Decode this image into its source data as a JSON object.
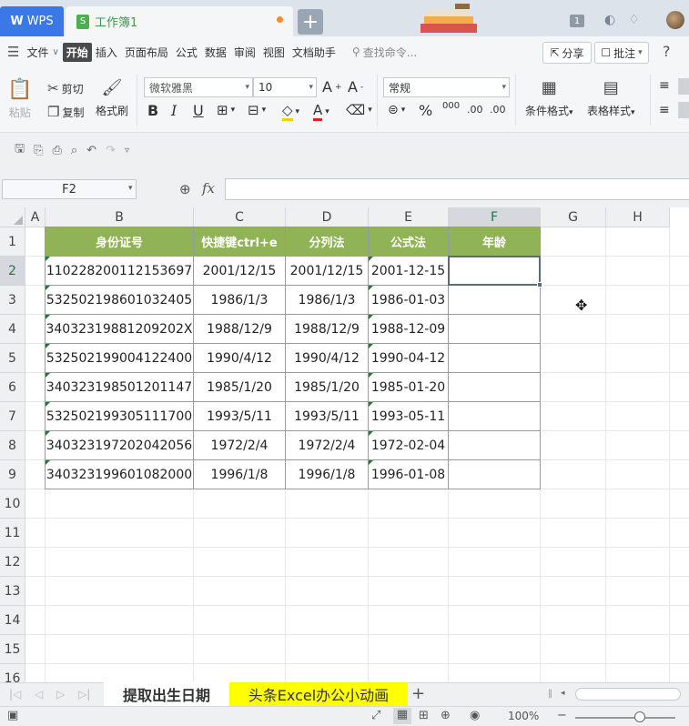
{
  "titlebar": {
    "app_tab": "WPS",
    "doc_tab": "工作簿1",
    "window_count": "1"
  },
  "menu": {
    "file": "文件",
    "items": [
      "开始",
      "插入",
      "页面布局",
      "公式",
      "数据",
      "审阅",
      "视图",
      "文档助手"
    ],
    "search_placeholder": "查找命令...",
    "share": "分享",
    "annotate": "批注",
    "help": "?"
  },
  "ribbon": {
    "paste": "粘贴",
    "cut": "剪切",
    "copy": "复制",
    "format_painter": "格式刷",
    "font_name": "微软雅黑",
    "font_size": "10",
    "number_format": "常规",
    "cond_format": "条件格式",
    "table_style": "表格样式",
    "decimal_inc": ".00",
    "decimal_dec": ".00"
  },
  "namebox": "F2",
  "columns": [
    "A",
    "B",
    "C",
    "D",
    "E",
    "F",
    "G",
    "H"
  ],
  "rows": [
    "1",
    "2",
    "3",
    "4",
    "5",
    "6",
    "7",
    "8",
    "9",
    "10",
    "11",
    "12",
    "13",
    "14",
    "15",
    "16"
  ],
  "table": {
    "headers": [
      "身份证号",
      "快捷键ctrl+e",
      "分列法",
      "公式法",
      "年龄"
    ],
    "data": [
      [
        "110228200112153697",
        "2001/12/15",
        "2001/12/15",
        "2001-12-15",
        ""
      ],
      [
        "532502198601032405",
        "1986/1/3",
        "1986/1/3",
        "1986-01-03",
        ""
      ],
      [
        "34032319881209202X",
        "1988/12/9",
        "1988/12/9",
        "1988-12-09",
        ""
      ],
      [
        "532502199004122400",
        "1990/4/12",
        "1990/4/12",
        "1990-04-12",
        ""
      ],
      [
        "340323198501201147",
        "1985/1/20",
        "1985/1/20",
        "1985-01-20",
        ""
      ],
      [
        "532502199305111700",
        "1993/5/11",
        "1993/5/11",
        "1993-05-11",
        ""
      ],
      [
        "340323197202042056",
        "1972/2/4",
        "1972/2/4",
        "1972-02-04",
        ""
      ],
      [
        "340323199601082000",
        "1996/1/8",
        "1996/1/8",
        "1996-01-08",
        ""
      ]
    ]
  },
  "sheets": [
    "提取出生日期",
    "头条Excel办公小动画"
  ],
  "status": {
    "zoom": "100%"
  },
  "colors": {
    "header_fill": "#8fb356",
    "wps_blue": "#3b78e7",
    "sheet2_fill": "#ffff00"
  }
}
